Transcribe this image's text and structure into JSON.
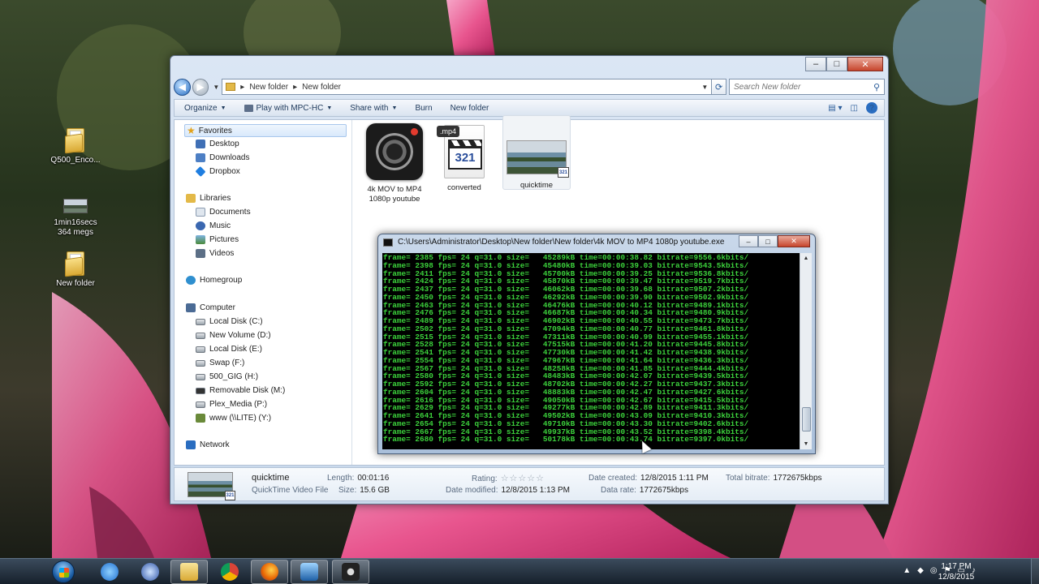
{
  "desktop": {
    "icons": [
      {
        "label": "Q500_Enco...",
        "icon": "folder-icon"
      },
      {
        "label": "1min16secs\n364 megs",
        "icon": "video-thumbnail-icon"
      },
      {
        "label": "New folder",
        "icon": "folder-icon"
      }
    ]
  },
  "explorer": {
    "breadcrumbs": [
      "New folder",
      "New folder"
    ],
    "search_placeholder": "Search New folder",
    "commands": [
      "Organize",
      "Play with MPC-HC",
      "Share with",
      "Burn",
      "New folder"
    ],
    "nav": {
      "favorites": "Favorites",
      "fav_items": [
        "Desktop",
        "Downloads",
        "Dropbox"
      ],
      "libraries": "Libraries",
      "lib_items": [
        "Documents",
        "Music",
        "Pictures",
        "Videos"
      ],
      "homegroup": "Homegroup",
      "computer": "Computer",
      "drives": [
        "Local Disk (C:)",
        "New Volume (D:)",
        "Local Disk (E:)",
        "Swap (F:)",
        "500_GIG (H:)",
        "Removable Disk (M:)",
        "Plex_Media (P:)",
        "www (\\\\LITE) (Y:)"
      ],
      "network": "Network"
    },
    "files": [
      {
        "name": "4k  MOV to MP4 1080p youtube",
        "icon": "camera-app-icon"
      },
      {
        "name": "converted",
        "icon": "mp4-file-icon",
        "badge": ".mp4",
        "clap_text": "321"
      },
      {
        "name": "quicktime",
        "icon": "video-thumbnail-icon"
      }
    ],
    "details": {
      "name": "quicktime",
      "type": "QuickTime Video File",
      "length_label": "Length:",
      "length": "00:01:16",
      "size_label": "Size:",
      "size": "15.6 GB",
      "rating_label": "Rating:",
      "rating_stars": "☆☆☆☆☆",
      "modified_label": "Date modified:",
      "modified": "12/8/2015 1:13 PM",
      "created_label": "Date created:",
      "created": "12/8/2015 1:11 PM",
      "datarate_label": "Data rate:",
      "datarate": "1772675kbps",
      "bitrate_label": "Total bitrate:",
      "bitrate": "1772675kbps"
    }
  },
  "console": {
    "title": "C:\\Users\\Administrator\\Desktop\\New folder\\New folder\\4k  MOV to MP4 1080p youtube.exe",
    "lines": [
      "frame= 2385 fps= 24 q=31.0 size=   45289kB time=00:00:38.82 bitrate=9556.6kbits/",
      "frame= 2398 fps= 24 q=31.0 size=   45480kB time=00:00:39.03 bitrate=9543.5kbits/",
      "frame= 2411 fps= 24 q=31.0 size=   45700kB time=00:00:39.25 bitrate=9536.8kbits/",
      "frame= 2424 fps= 24 q=31.0 size=   45870kB time=00:00:39.47 bitrate=9519.7kbits/",
      "frame= 2437 fps= 24 q=31.0 size=   46062kB time=00:00:39.68 bitrate=9507.2kbits/",
      "frame= 2450 fps= 24 q=31.0 size=   46292kB time=00:00:39.90 bitrate=9502.9kbits/",
      "frame= 2463 fps= 24 q=31.0 size=   46476kB time=00:00:40.12 bitrate=9489.1kbits/",
      "frame= 2476 fps= 24 q=31.0 size=   46687kB time=00:00:40.34 bitrate=9480.9kbits/",
      "frame= 2489 fps= 24 q=31.0 size=   46902kB time=00:00:40.55 bitrate=9473.7kbits/",
      "frame= 2502 fps= 24 q=31.0 size=   47094kB time=00:00:40.77 bitrate=9461.8kbits/",
      "frame= 2515 fps= 24 q=31.0 size=   47311kB time=00:00:40.99 bitrate=9455.1kbits/",
      "frame= 2528 fps= 24 q=31.0 size=   47515kB time=00:00:41.20 bitrate=9445.8kbits/",
      "frame= 2541 fps= 24 q=31.0 size=   47730kB time=00:00:41.42 bitrate=9438.9kbits/",
      "frame= 2554 fps= 24 q=31.0 size=   47967kB time=00:00:41.64 bitrate=9436.3kbits/",
      "frame= 2567 fps= 24 q=31.0 size=   48258kB time=00:00:41.85 bitrate=9444.4kbits/",
      "frame= 2580 fps= 24 q=31.0 size=   48483kB time=00:00:42.07 bitrate=9439.5kbits/",
      "frame= 2592 fps= 24 q=31.0 size=   48702kB time=00:00:42.27 bitrate=9437.3kbits/",
      "frame= 2604 fps= 24 q=31.0 size=   48883kB time=00:00:42.47 bitrate=9427.6kbits/",
      "frame= 2616 fps= 24 q=31.0 size=   49050kB time=00:00:42.67 bitrate=9415.5kbits/",
      "frame= 2629 fps= 24 q=31.0 size=   49277kB time=00:00:42.89 bitrate=9411.3kbits/",
      "frame= 2641 fps= 24 q=31.0 size=   49502kB time=00:00:43.09 bitrate=9410.3kbits/",
      "frame= 2654 fps= 24 q=31.0 size=   49710kB time=00:00:43.30 bitrate=9402.6kbits/",
      "frame= 2667 fps= 24 q=31.0 size=   49937kB time=00:00:43.52 bitrate=9398.4kbits/",
      "frame= 2680 fps= 24 q=31.0 size=   50178kB time=00:00:43.74 bitrate=9397.0kbits/"
    ]
  },
  "taskbar": {
    "apps": [
      "internet-explorer-icon",
      "thunderbird-icon",
      "file-explorer-icon",
      "chrome-icon",
      "firefox-icon",
      "media-player-icon",
      "camera-app-icon"
    ],
    "time": "1:17 PM",
    "date": "12/8/2015"
  },
  "colors": {
    "console_text": "#3cd23c",
    "accent": "#2a6dc0"
  }
}
